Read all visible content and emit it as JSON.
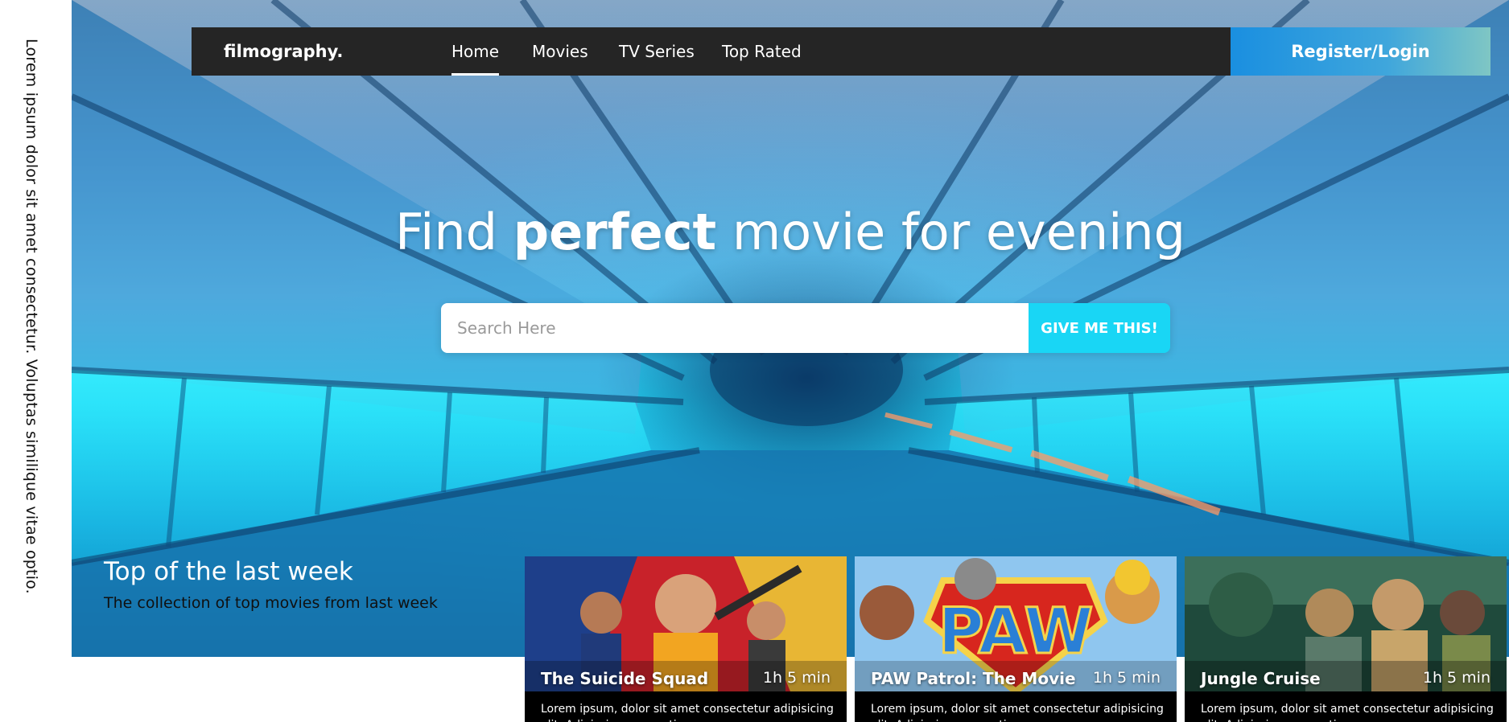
{
  "side_text": "Lorem ipsum dolor sit amet consectetur. Voluptas similique vitae optio.",
  "navbar": {
    "brand": "filmography.",
    "items": [
      {
        "label": "Home",
        "active": true
      },
      {
        "label": "Movies",
        "active": false
      },
      {
        "label": "TV Series",
        "active": false
      },
      {
        "label": "Top Rated",
        "active": false
      }
    ],
    "register_label": "Register/Login"
  },
  "hero": {
    "headline_pre": "Find ",
    "headline_bold": "perfect",
    "headline_post": " movie for evening",
    "search": {
      "placeholder": "Search Here",
      "value": "",
      "button_label": "GIVE ME THIS!"
    }
  },
  "top_week": {
    "title": "Top of the last week",
    "subtitle": "The collection of top movies from last week"
  },
  "cards": [
    {
      "title": "The Suicide Squad",
      "duration": "1h 5 min",
      "description": "Lorem ipsum, dolor sit amet consectetur adipisicing elit. Adipisci, neque optio."
    },
    {
      "title": "PAW Patrol: The Movie",
      "duration": "1h 5 min",
      "description": "Lorem ipsum, dolor sit amet consectetur adipisicing elit. Adipisci, neque optio."
    },
    {
      "title": "Jungle Cruise",
      "duration": "1h 5 min",
      "description": "Lorem ipsum, dolor sit amet consectetur adipisicing elit. Adipisci, neque optio."
    }
  ],
  "colors": {
    "navbar_bg": "#252525",
    "accent_cyan": "#19d6f5",
    "register_gradient_start": "#1a8fe0",
    "register_gradient_end": "#7fc6c4"
  }
}
